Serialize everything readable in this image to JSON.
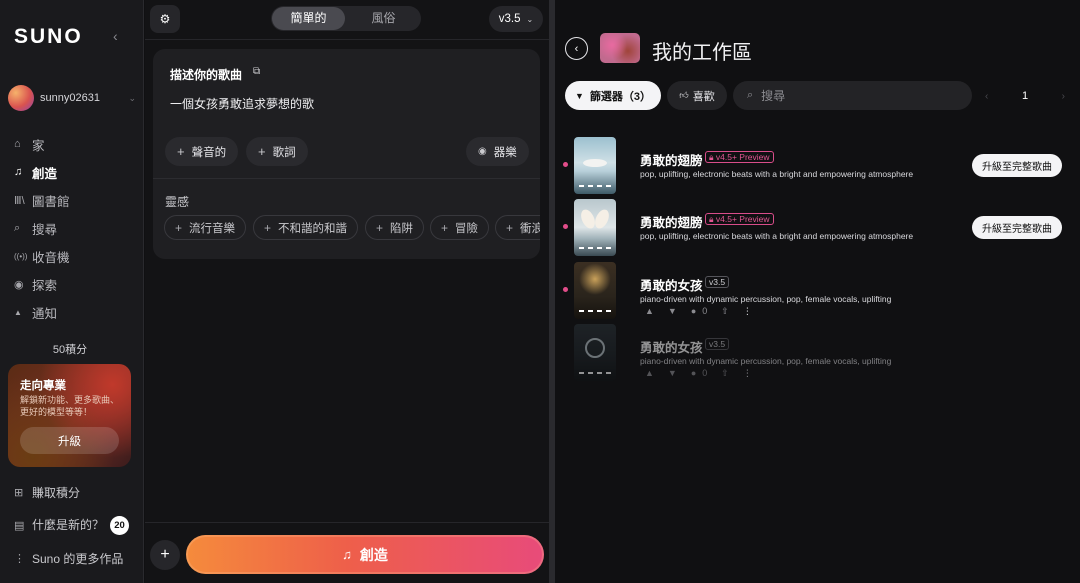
{
  "sidebar": {
    "logo": "SUNO",
    "collapse_icon": "‹",
    "username": "sunny02631",
    "nav": [
      {
        "icon": "⌂",
        "label": "家"
      },
      {
        "icon": "♫",
        "label": "創造"
      },
      {
        "icon": "Ⅲ\\",
        "label": "圖書館"
      },
      {
        "icon": "⌕",
        "label": "搜尋"
      },
      {
        "icon": "((•))",
        "label": "收音機"
      },
      {
        "icon": "◉",
        "label": "探索"
      },
      {
        "icon": "▲",
        "label": "通知"
      }
    ],
    "credits": "50積分",
    "promo": {
      "title": "走向專業",
      "description": "解鎖新功能、更多歌曲、更好的模型等等！",
      "button": "升級"
    },
    "earn_credits": "賺取積分",
    "whats_new": "什麼是新的？",
    "whats_new_count": "20",
    "more_from_suno": "Suno 的更多作品"
  },
  "create": {
    "modes": [
      "簡單的",
      "風俗"
    ],
    "active_mode": "簡單的",
    "version": "v3.5",
    "describe_label": "描述你的歌曲",
    "prompt": "一個女孩勇敢追求夢想的歌",
    "chips": {
      "audio": "聲音的",
      "lyrics": "歌詞",
      "instrumental": "器樂"
    },
    "inspiration_label": "靈感",
    "inspiration": [
      "流行音樂",
      "不和諧的和諧",
      "陷阱",
      "冒險",
      "衝浪"
    ],
    "create_button": "創造"
  },
  "workspace": {
    "title": "我的工作區",
    "filter_label": "篩選器（3）",
    "like_label": "喜歡",
    "search_placeholder": "搜尋",
    "page": "1",
    "songs": [
      {
        "title": "勇敢的翅膀",
        "version": "v4.5+ Preview",
        "style": "pop, uplifting, electronic beats with a bright and empowering atmosphere",
        "upgrade": "升級至完整歌曲"
      },
      {
        "title": "勇敢的翅膀",
        "version": "v4.5+ Preview",
        "style": "pop, uplifting, electronic beats with a bright and empowering atmosphere",
        "upgrade": "升級至完整歌曲"
      },
      {
        "title": "勇敢的女孩",
        "version": "v3.5",
        "style": "piano-driven with dynamic percussion, pop, female vocals, uplifting",
        "comments": "0"
      },
      {
        "title": "勇敢的女孩",
        "version": "v3.5",
        "style": "piano-driven with dynamic percussion, pop, female vocals, uplifting",
        "comments": "0"
      }
    ]
  },
  "colors": {
    "accent_pink": "#e24d8a",
    "create_gradient_start": "#f58b3c",
    "create_gradient_end": "#e84b7a"
  }
}
